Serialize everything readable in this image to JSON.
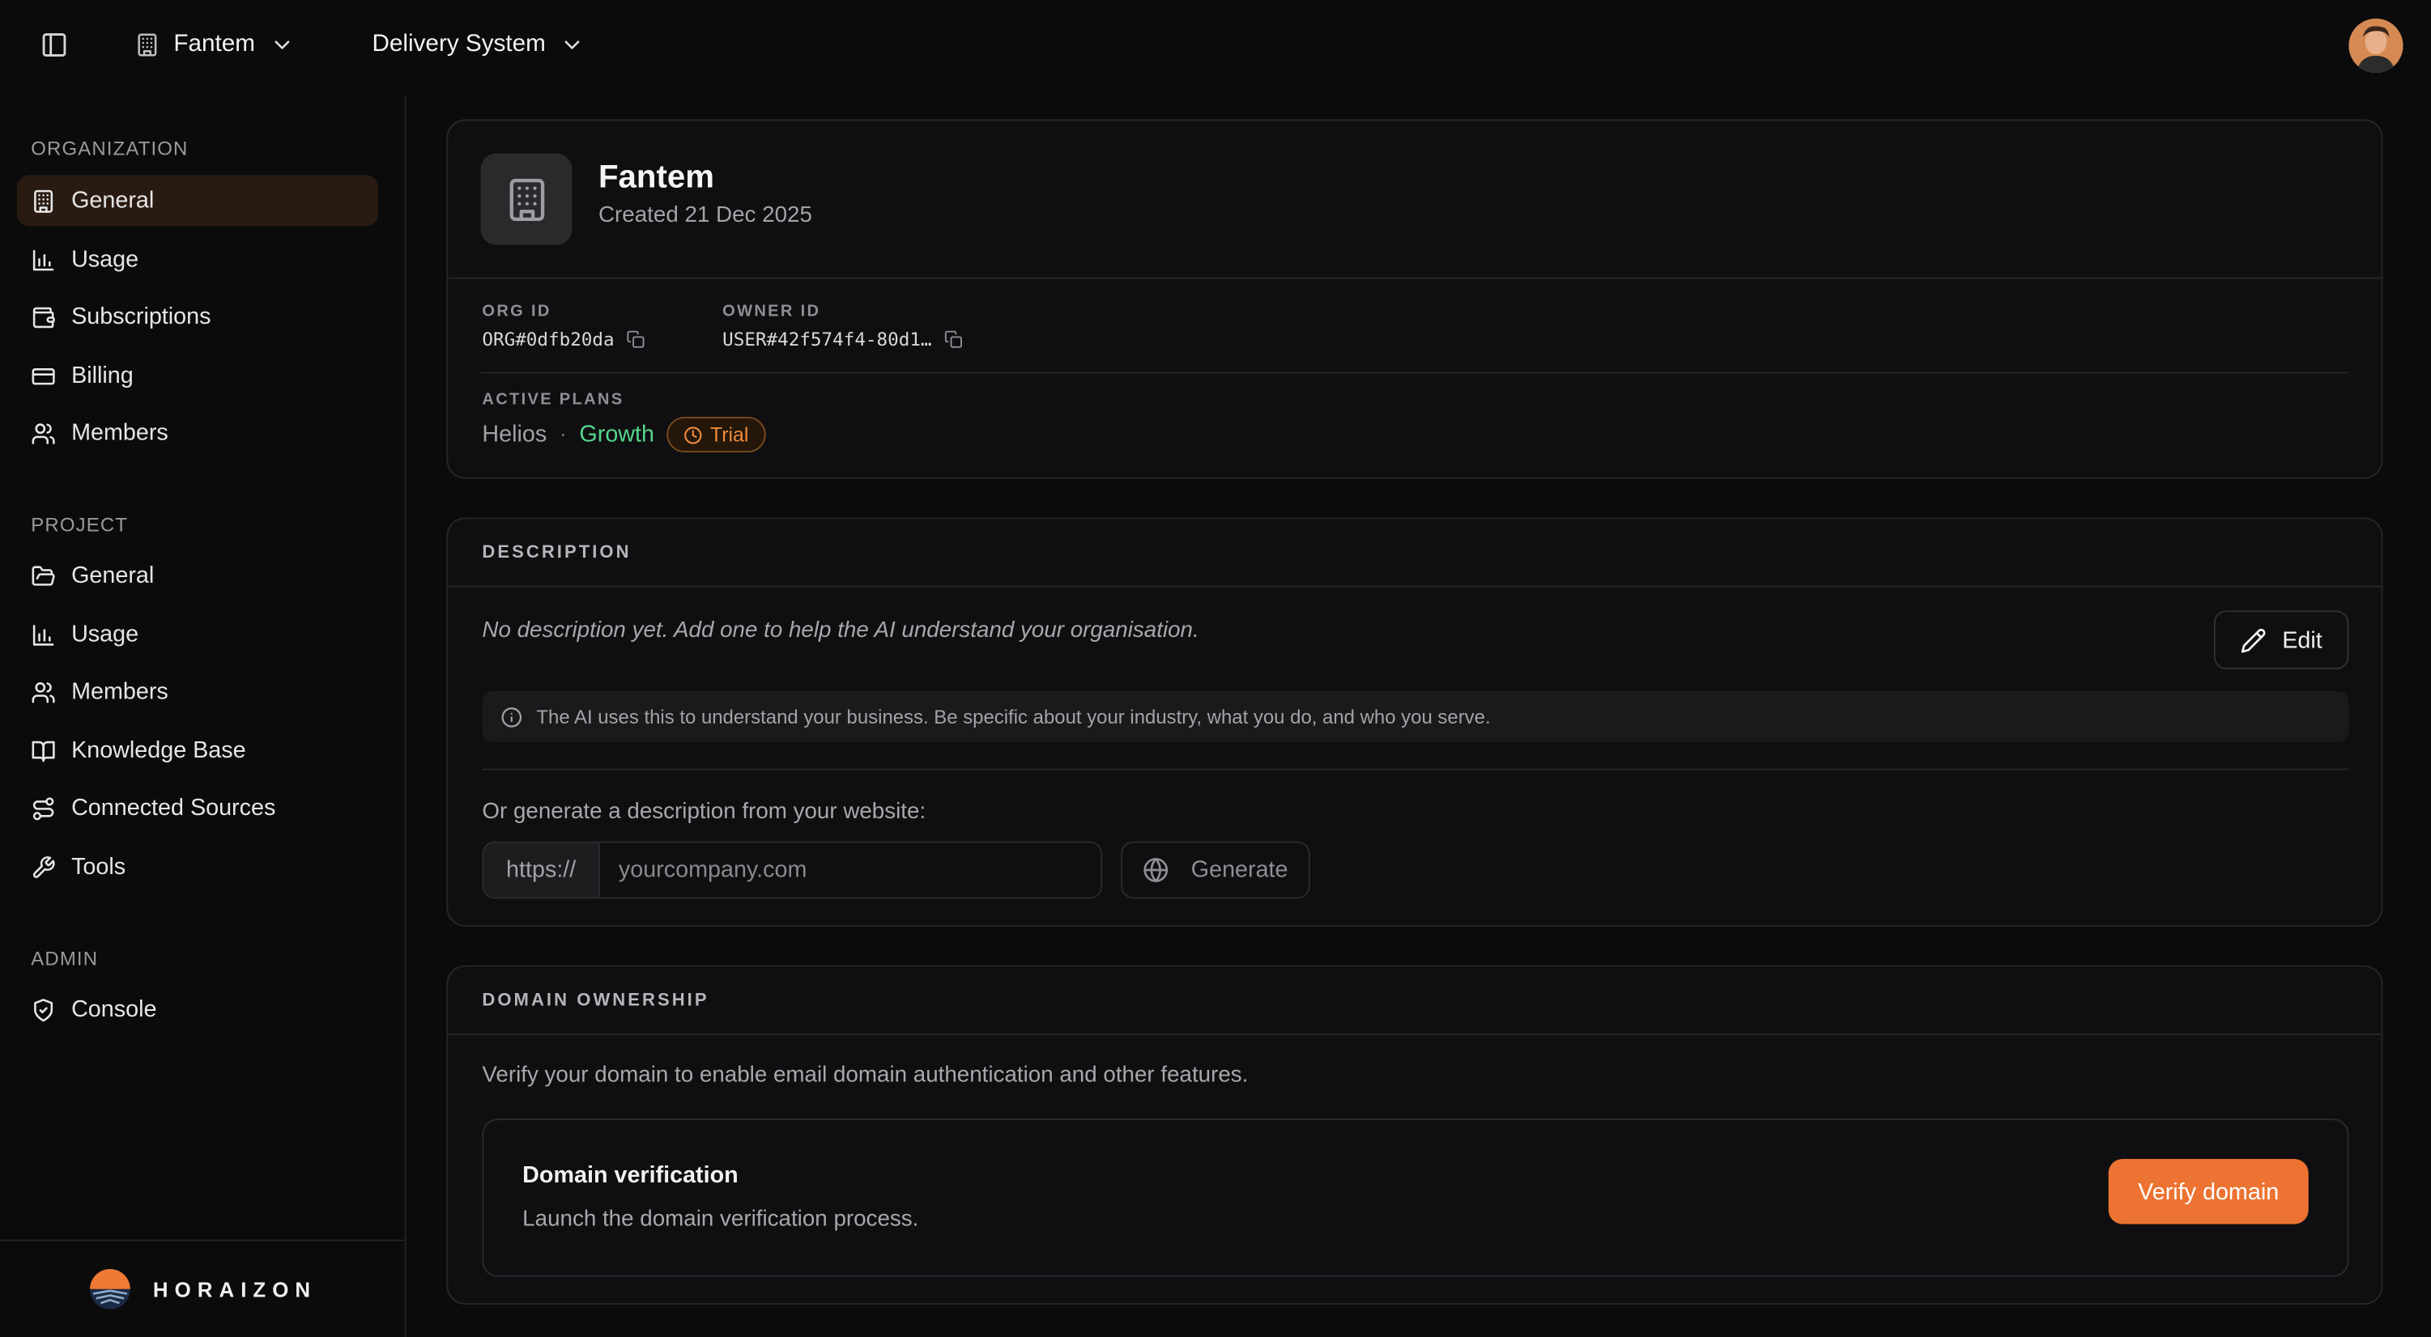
{
  "topbar": {
    "org_name": "Fantem",
    "project_name": "Delivery System"
  },
  "sidebar": {
    "sections": {
      "organization": "ORGANIZATION",
      "project": "PROJECT",
      "admin": "ADMIN"
    },
    "org_items": [
      {
        "label": "General",
        "icon": "building-icon",
        "active": true
      },
      {
        "label": "Usage",
        "icon": "bar-chart-icon"
      },
      {
        "label": "Subscriptions",
        "icon": "wallet-icon"
      },
      {
        "label": "Billing",
        "icon": "credit-card-icon"
      },
      {
        "label": "Members",
        "icon": "users-icon"
      }
    ],
    "project_items": [
      {
        "label": "General",
        "icon": "folder-open-icon"
      },
      {
        "label": "Usage",
        "icon": "bar-chart-icon"
      },
      {
        "label": "Members",
        "icon": "users-icon"
      },
      {
        "label": "Knowledge Base",
        "icon": "book-open-icon"
      },
      {
        "label": "Connected Sources",
        "icon": "route-icon"
      },
      {
        "label": "Tools",
        "icon": "wrench-icon"
      }
    ],
    "admin_items": [
      {
        "label": "Console",
        "icon": "shield-check-icon"
      }
    ],
    "brand": "HORAIZON"
  },
  "org_card": {
    "name": "Fantem",
    "created": "Created 21 Dec 2025",
    "org_id_label": "ORG ID",
    "org_id": "ORG#0dfb20da",
    "owner_id_label": "OWNER ID",
    "owner_id": "USER#42f574f4-80d1…",
    "plans_label": "ACTIVE PLANS",
    "plan_name": "Helios",
    "plan_sep": "·",
    "plan_tier": "Growth",
    "badge": "Trial"
  },
  "description": {
    "header": "DESCRIPTION",
    "empty_text": "No description yet. Add one to help the AI understand your organisation.",
    "edit_label": "Edit",
    "hint": "The AI uses this to understand your business. Be specific about your industry, what you do, and who you serve.",
    "generate_label": "Or generate a description from your website:",
    "url_prefix": "https://",
    "url_placeholder": "yourcompany.com",
    "url_value": "",
    "generate_button": "Generate"
  },
  "domain": {
    "header": "DOMAIN OWNERSHIP",
    "description": "Verify your domain to enable email domain authentication and other features.",
    "box_title": "Domain verification",
    "box_subtitle": "Launch the domain verification process.",
    "verify_button": "Verify domain"
  },
  "colors": {
    "accent": "#ec7332",
    "active_nav_bg": "#2a1b12",
    "growth": "#55d68b",
    "trial": "#f08a3c"
  }
}
